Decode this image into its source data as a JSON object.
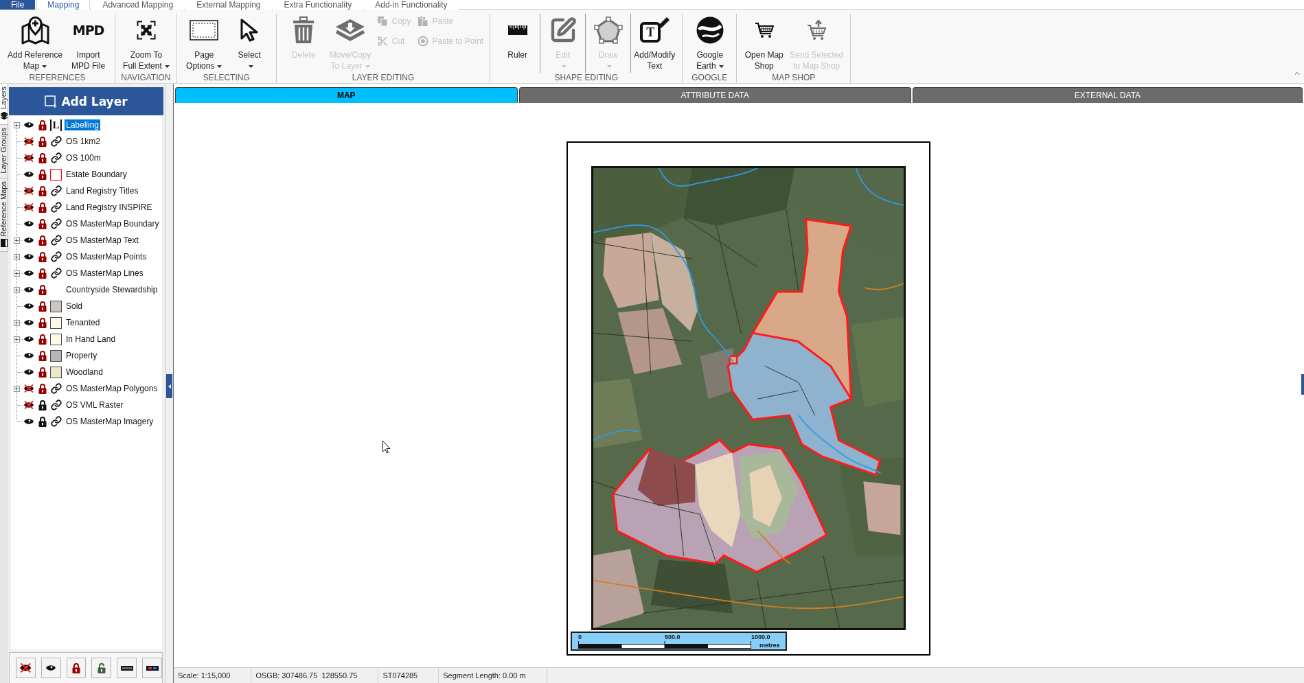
{
  "menu_tabs": [
    {
      "label": "File",
      "kind": "file",
      "selected": false
    },
    {
      "label": "Mapping",
      "kind": "tab",
      "selected": true
    },
    {
      "label": "Advanced Mapping",
      "kind": "tab",
      "selected": false
    },
    {
      "label": "External Mapping",
      "kind": "tab",
      "selected": false
    },
    {
      "label": "Extra Functionality",
      "kind": "tab",
      "selected": false
    },
    {
      "label": "Add-in Functionality",
      "kind": "tab",
      "selected": false
    }
  ],
  "ribbon": {
    "groups": [
      {
        "label": "REFERENCES",
        "items": [
          {
            "kind": "large",
            "lines": [
              "Add Reference",
              "Map"
            ],
            "dropdown": true,
            "disabled": false
          },
          {
            "kind": "large",
            "icon_text": "MPD",
            "lines": [
              "Import",
              "MPD File"
            ],
            "dropdown": false,
            "disabled": false
          }
        ]
      },
      {
        "label": "NAVIGATION",
        "items": [
          {
            "kind": "large",
            "lines": [
              "Zoom To",
              "Full Extent"
            ],
            "dropdown": true,
            "disabled": false
          }
        ]
      },
      {
        "label": "SELECTING",
        "items": [
          {
            "kind": "large",
            "lines": [
              "Page",
              "Options"
            ],
            "dropdown": true,
            "disabled": false
          },
          {
            "kind": "large",
            "lines": [
              "Select"
            ],
            "dropdown": true,
            "disabled": false
          }
        ]
      },
      {
        "label": "LAYER EDITING",
        "items": [
          {
            "kind": "large",
            "lines": [
              "Delete"
            ],
            "dropdown": false,
            "disabled": true
          },
          {
            "kind": "large",
            "lines": [
              "Move/Copy",
              "To Layer"
            ],
            "dropdown": true,
            "disabled": true
          },
          {
            "kind": "small",
            "label": "Copy",
            "disabled": true
          },
          {
            "kind": "small",
            "label": "Paste",
            "disabled": true
          },
          {
            "kind": "small",
            "label": "Cut",
            "disabled": true
          },
          {
            "kind": "small",
            "label": "Paste to Point",
            "disabled": true
          }
        ]
      },
      {
        "label": "SHAPE EDITING",
        "divided": true,
        "items": [
          {
            "kind": "large",
            "lines": [
              "Ruler"
            ],
            "dropdown": false,
            "disabled": false
          },
          {
            "kind": "large",
            "lines": [
              "Edit"
            ],
            "dropdown": true,
            "disabled": true
          },
          {
            "kind": "large",
            "lines": [
              "Draw"
            ],
            "dropdown": true,
            "disabled": true
          },
          {
            "kind": "large",
            "icon_text": "T",
            "lines": [
              "Add/Modify",
              "Text"
            ],
            "dropdown": false,
            "disabled": false
          }
        ]
      },
      {
        "label": "GOOGLE",
        "items": [
          {
            "kind": "large",
            "lines": [
              "Google",
              "Earth"
            ],
            "dropdown": true,
            "disabled": false
          }
        ]
      },
      {
        "label": "MAP SHOP",
        "items": [
          {
            "kind": "large",
            "lines": [
              "Open Map",
              "Shop"
            ],
            "dropdown": false,
            "disabled": false
          },
          {
            "kind": "large",
            "lines": [
              "Send Selected",
              "to Map Shop"
            ],
            "dropdown": false,
            "disabled": true
          }
        ]
      }
    ]
  },
  "side_tabs": [
    {
      "label": "Layers",
      "selected": true
    },
    {
      "label": "Layer Groups",
      "selected": false
    },
    {
      "label": "Reference Maps",
      "selected": false
    }
  ],
  "layer_panel": {
    "title": "Add Layer",
    "layers": [
      {
        "name": "Labelling",
        "kind": "label",
        "symbol_text": "L",
        "expandable": true,
        "visible": true,
        "locked": true,
        "selected": true
      },
      {
        "name": "OS 1km2",
        "kind": "link",
        "expandable": false,
        "visible": false,
        "locked": true,
        "selected": false
      },
      {
        "name": "OS 100m",
        "kind": "link",
        "expandable": false,
        "visible": false,
        "locked": true,
        "selected": false
      },
      {
        "name": "Estate Boundary",
        "kind": "outline",
        "color": "#ff0000",
        "expandable": false,
        "visible": true,
        "locked": true,
        "selected": false
      },
      {
        "name": "Land Registry Titles",
        "kind": "link",
        "expandable": false,
        "visible": false,
        "locked": true,
        "selected": false
      },
      {
        "name": "Land Registry INSPIRE",
        "kind": "link",
        "expandable": false,
        "visible": false,
        "locked": true,
        "selected": false
      },
      {
        "name": "OS MasterMap Boundary",
        "kind": "link",
        "expandable": false,
        "visible": true,
        "locked": true,
        "selected": false
      },
      {
        "name": "OS MasterMap Text",
        "kind": "link",
        "expandable": true,
        "visible": true,
        "locked": true,
        "selected": false
      },
      {
        "name": "OS MasterMap Points",
        "kind": "link",
        "expandable": true,
        "visible": true,
        "locked": true,
        "selected": false
      },
      {
        "name": "OS MasterMap Lines",
        "kind": "link",
        "expandable": true,
        "visible": true,
        "locked": true,
        "selected": false
      },
      {
        "name": "Countryside Stewardship",
        "kind": "none",
        "expandable": true,
        "visible": true,
        "locked": true,
        "selected": false
      },
      {
        "name": "Sold",
        "kind": "fill",
        "color": "#cdc5c5",
        "expandable": false,
        "visible": true,
        "locked": true,
        "selected": false
      },
      {
        "name": "Tenanted",
        "kind": "fill",
        "color": "#fff9e6",
        "expandable": true,
        "visible": true,
        "locked": true,
        "selected": false
      },
      {
        "name": "In Hand Land",
        "kind": "fill",
        "color": "#fffae8",
        "expandable": true,
        "visible": true,
        "locked": true,
        "selected": false
      },
      {
        "name": "Property",
        "kind": "fill",
        "color": "#b9b3bd",
        "expandable": false,
        "visible": true,
        "locked": true,
        "selected": false
      },
      {
        "name": "Woodland",
        "kind": "fill",
        "color": "#ece7c6",
        "expandable": false,
        "visible": true,
        "locked": true,
        "selected": false
      },
      {
        "name": "OS MasterMap Polygons",
        "kind": "link",
        "expandable": true,
        "visible": false,
        "locked": true,
        "selected": false
      },
      {
        "name": "OS VML Raster",
        "kind": "link",
        "expandable": false,
        "visible": false,
        "locked": false,
        "selected": false
      },
      {
        "name": "OS MasterMap Imagery",
        "kind": "link",
        "expandable": false,
        "visible": true,
        "locked": false,
        "selected": false
      }
    ]
  },
  "view_tabs": [
    {
      "label": "MAP",
      "selected": true
    },
    {
      "label": "ATTRIBUTE DATA",
      "selected": false
    },
    {
      "label": "EXTERNAL DATA",
      "selected": false
    }
  ],
  "map": {
    "scale_bar": {
      "ticks": [
        "0",
        "500.0",
        "1000.0"
      ],
      "unit": "metres"
    }
  },
  "status_bar": {
    "cells": [
      "Scale: 1:15,000",
      "OSGB: 307486.75  128550.75",
      "ST074285",
      "Segment Length: 0.00 m"
    ]
  }
}
